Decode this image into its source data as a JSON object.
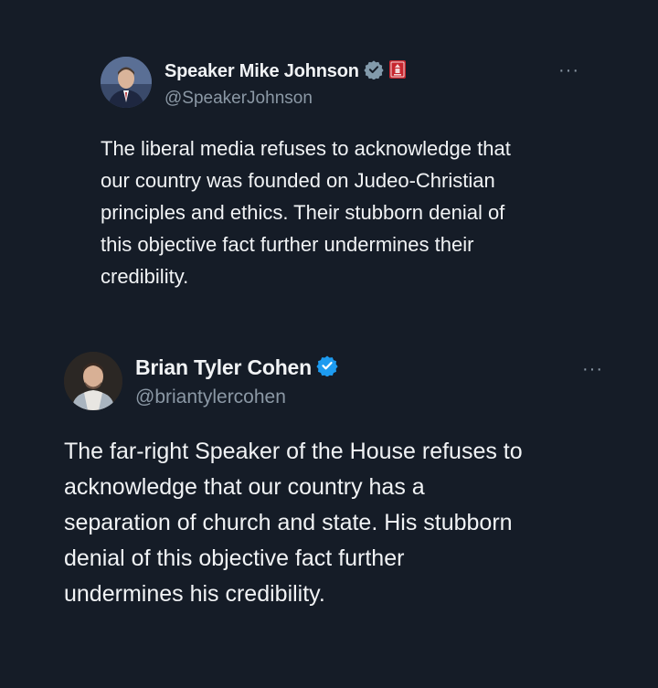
{
  "tweets": [
    {
      "display_name": "Speaker Mike Johnson",
      "handle": "@SpeakerJohnson",
      "badge": "gray-verified-icon",
      "affiliate_badge": "house-seal-icon",
      "more_label": "···",
      "text": "The liberal media refuses to acknowledge that\nour country was founded on Judeo-Christian\nprinciples and ethics. Their stubborn denial of\nthis objective fact further undermines their\ncredibility."
    },
    {
      "display_name": "Brian Tyler Cohen",
      "handle": "@briantylercohen",
      "badge": "blue-verified-icon",
      "more_label": "···",
      "text": "The far-right Speaker of the House refuses to\nacknowledge that our country has a\nseparation of church and state. His stubborn\ndenial of this objective fact further\nundermines his credibility."
    }
  ],
  "colors": {
    "background": "#151c27",
    "text": "#f1f3f5",
    "secondary": "#8b98a5",
    "verified_blue": "#1d9bf0",
    "verified_gray": "#829aab",
    "seal_red": "#c7262e"
  }
}
